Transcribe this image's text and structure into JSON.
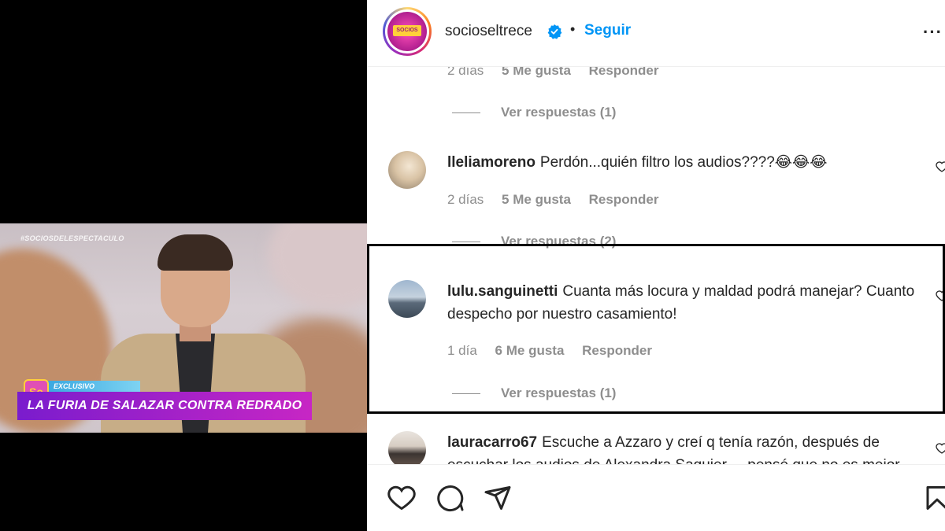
{
  "video": {
    "hashtag": "#SOCIOSDELESPECTACULO",
    "logo": "So",
    "tag": "EXCLUSIVO",
    "headline": "LA FURIA DE SALAZAR CONTRA REDRADO"
  },
  "header": {
    "username": "socioseltrece",
    "avatar_label": "SOCIOS",
    "separator": "•",
    "follow_label": "Seguir",
    "more_label": "···",
    "verified_icon": "verified-badge-icon"
  },
  "cut_meta": {
    "time": "2 días",
    "likes": "5 Me gusta",
    "reply": "Responder"
  },
  "replies_1": {
    "label": "Ver respuestas (1)"
  },
  "comments": [
    {
      "user": "lleliamoreno",
      "text": "Perdón...quién filtro los audios????😂😂😂",
      "time": "2 días",
      "likes": "5 Me gusta",
      "reply": "Responder",
      "replies": "Ver respuestas (2)"
    },
    {
      "user": "lulu.sanguinetti",
      "text": "Cuanta más locura y maldad podrá manejar? Cuanto despecho por nuestro casamiento!",
      "time": "1 día",
      "likes": "6 Me gusta",
      "reply": "Responder",
      "replies": "Ver respuestas (1)"
    },
    {
      "user": "lauracarro67",
      "text": "Escuche a Azzaro y creí q tenía razón, después de escuchar los audios de Alexandra Saguier ... pensé que no es mejor...",
      "time": "",
      "likes": "",
      "reply": "",
      "replies": ""
    }
  ],
  "actions": {
    "like_icon": "heart-icon",
    "comment_icon": "comment-icon",
    "share_icon": "share-icon",
    "save_icon": "bookmark-icon"
  },
  "colors": {
    "accent": "#0095f6",
    "text": "#262626",
    "secondary": "#8e8e8e"
  }
}
